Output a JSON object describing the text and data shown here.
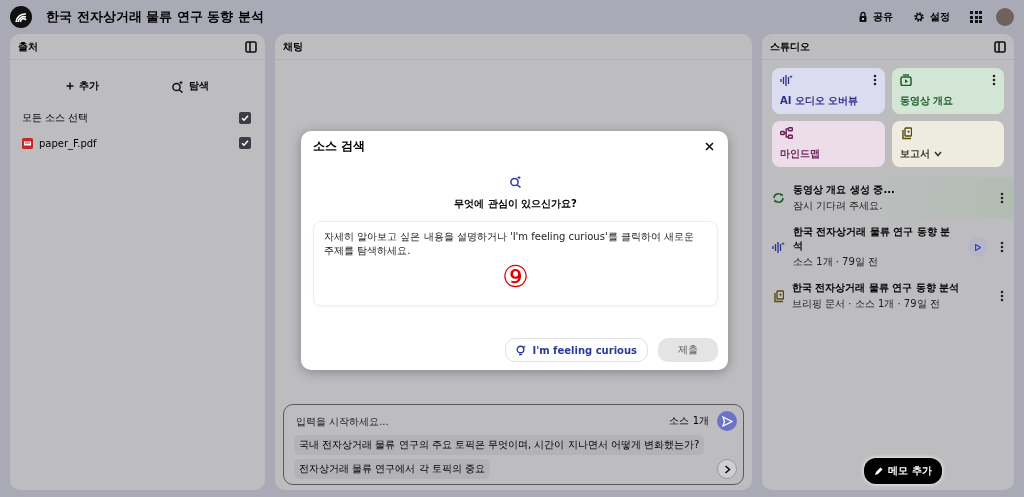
{
  "header": {
    "title": "한국 전자상거래 물류 연구 동향 분석",
    "actions": [
      {
        "kind": "share",
        "label": "공유"
      },
      {
        "kind": "settings",
        "label": "설정"
      }
    ]
  },
  "sources": {
    "title": "출처",
    "add_label": "추가",
    "discover_label": "탐색",
    "select_all": {
      "label": "모든 소스 선택",
      "checked": true
    },
    "items": [
      {
        "name": "paper_F.pdf",
        "checked": true
      }
    ]
  },
  "chat": {
    "title": "채팅",
    "input": {
      "placeholder": "입력을 시작하세요...",
      "source_count": "소스 1개"
    },
    "suggestions": [
      "국내 전자상거래 물류 연구의 주요 토픽은 무엇이며, 시간이 지나면서 어떻게 변화했는가?",
      "전자상거래 물류 연구에서 각 토픽의 중요"
    ]
  },
  "studio": {
    "title": "스튜디오",
    "tools": [
      {
        "kind": "audio",
        "label": "AI 오디오 오버뷰",
        "color": "#dcdcf0",
        "menu": true
      },
      {
        "kind": "video",
        "label": "동영상 개요",
        "color": "#d3e6d6",
        "menu": true
      },
      {
        "kind": "mindmap",
        "label": "마인드맵",
        "color": "#ecdde8",
        "menu": false
      },
      {
        "kind": "report",
        "label": "보고서",
        "color": "#eeecdf",
        "menu": false
      }
    ],
    "artifacts": [
      {
        "kind": "generating",
        "title": "동영상 개요 생성 중...",
        "subtitle": "잠시 기다려 주세요."
      },
      {
        "kind": "audio",
        "title": "한국 전자상거래 물류 연구 동향 분석",
        "subtitle": "소스 1개 · 79일 전"
      },
      {
        "kind": "report",
        "title": "한국 전자상거래 물류 연구 동향 분석",
        "subtitle": "브리핑 문서 · 소스 1개 · 79일 전"
      }
    ],
    "note_button": "메모 추가"
  },
  "dialog": {
    "title": "소스 검색",
    "question": "무엇에 관심이 있으신가요?",
    "placeholder": "자세히 알아보고 싶은 내용을 설명하거나 'I'm feeling curious'를 클릭하여 새로운 주제를 탐색하세요.",
    "annotation": "⑨",
    "curious_button": "I'm feeling curious",
    "submit_button": {
      "label": "제출",
      "disabled": true
    }
  }
}
